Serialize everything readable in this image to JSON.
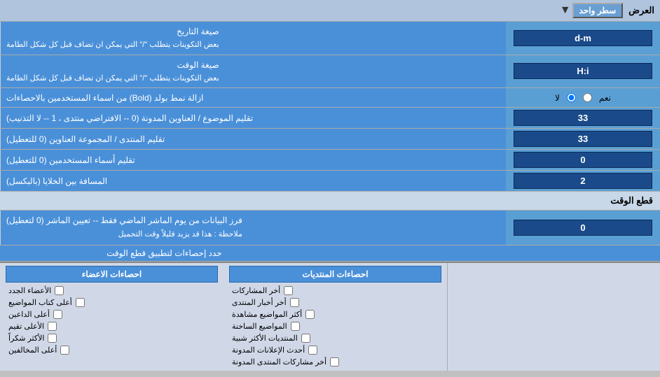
{
  "header": {
    "label": "العرض",
    "dropdown_label": "سطر واحد"
  },
  "rows": [
    {
      "id": "date-format",
      "label": "صيغة التاريخ\nبعض التكوينات يتطلب \"/\" التي يمكن ان تضاف قبل كل شكل الطامة",
      "input_value": "d-m",
      "type": "input"
    },
    {
      "id": "time-format",
      "label": "صيغة الوقت\nبعض التكوينات يتطلب \"/\" التي يمكن ان تضاف قبل كل شكل الطامة",
      "input_value": "H:i",
      "type": "input"
    },
    {
      "id": "bold-remove",
      "label": "ازالة نمط بولد (Bold) من اسماء المستخدمين بالاحصاءات",
      "radio_yes": "نعم",
      "radio_no": "لا",
      "selected": "no",
      "type": "radio"
    },
    {
      "id": "topic-limit",
      "label": "تقليم الموضوع / العناوين المدونة (0 -- الافتراضي منتدى ، 1 -- لا التذنيب)",
      "input_value": "33",
      "type": "input"
    },
    {
      "id": "forum-limit",
      "label": "تقليم المنتدى / المجموعة العناوين (0 للتعطيل)",
      "input_value": "33",
      "type": "input"
    },
    {
      "id": "user-limit",
      "label": "تقليم أسماء المستخدمين (0 للتعطيل)",
      "input_value": "0",
      "type": "input"
    },
    {
      "id": "cell-space",
      "label": "المسافة بين الخلايا (بالبكسل)",
      "input_value": "2",
      "type": "input"
    }
  ],
  "realtime_section": {
    "title": "قطع الوقت",
    "row_label": "فرز البيانات من يوم الماشر الماضي فقط -- تعيين الماشر (0 لتعطيل)\nملاحظة : هذا قد يزيد قليلاً وقت التحميل",
    "input_value": "0",
    "limit_label": "حدد إحصاءات لتطبيق قطع الوقت"
  },
  "stats": {
    "col_posts": {
      "header": "احصاءات المنتديات",
      "items": [
        "أخر المشاركات",
        "أخر أخبار المنتدى",
        "أكثر المواضيع مشاهدة",
        "المواضيع الساخنة",
        "المنتديات الأكثر شبية",
        "أحدث الإعلانات المدونة",
        "أخر مشاركات المنتدى المدونة"
      ]
    },
    "col_members": {
      "header": "احصاءات الاعضاء",
      "items": [
        "الأعضاء الجدد",
        "أعلى كتاب المواضيع",
        "أعلى الداعين",
        "الأعلى تقيم",
        "الأكثر شكراً",
        "أعلى المخالفين"
      ]
    },
    "empty_col": {}
  }
}
